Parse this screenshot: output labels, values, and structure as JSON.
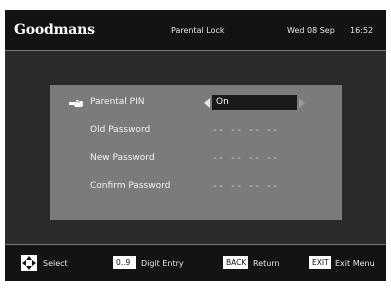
{
  "header": {
    "brand": "Goodmans",
    "title": "Parental Lock",
    "date": "Wed 08 Sep",
    "time": "16:52"
  },
  "menu": {
    "rows": [
      {
        "label": "Parental PIN",
        "value": "On"
      },
      {
        "label": "Old Password",
        "value": "-- -- -- --"
      },
      {
        "label": "New Password",
        "value": "-- -- -- --"
      },
      {
        "label": "Confirm Password",
        "value": "-- -- -- --"
      }
    ]
  },
  "footer": {
    "select_label": "Select",
    "digit_key": "0..9",
    "digit_label": "Digit Entry",
    "back_key": "BACK",
    "back_label": "Return",
    "exit_key": "EXIT",
    "exit_label": "Exit Menu"
  },
  "icons": {
    "pointer": "pointing-hand-icon",
    "left": "arrow-left-icon",
    "right": "arrow-right-icon",
    "dpad": "dpad-icon"
  },
  "colors": {
    "panel": "#7b7b7b",
    "background": "#2b2b2b",
    "bar": "#131313",
    "value_box": "#1a1a1a"
  }
}
